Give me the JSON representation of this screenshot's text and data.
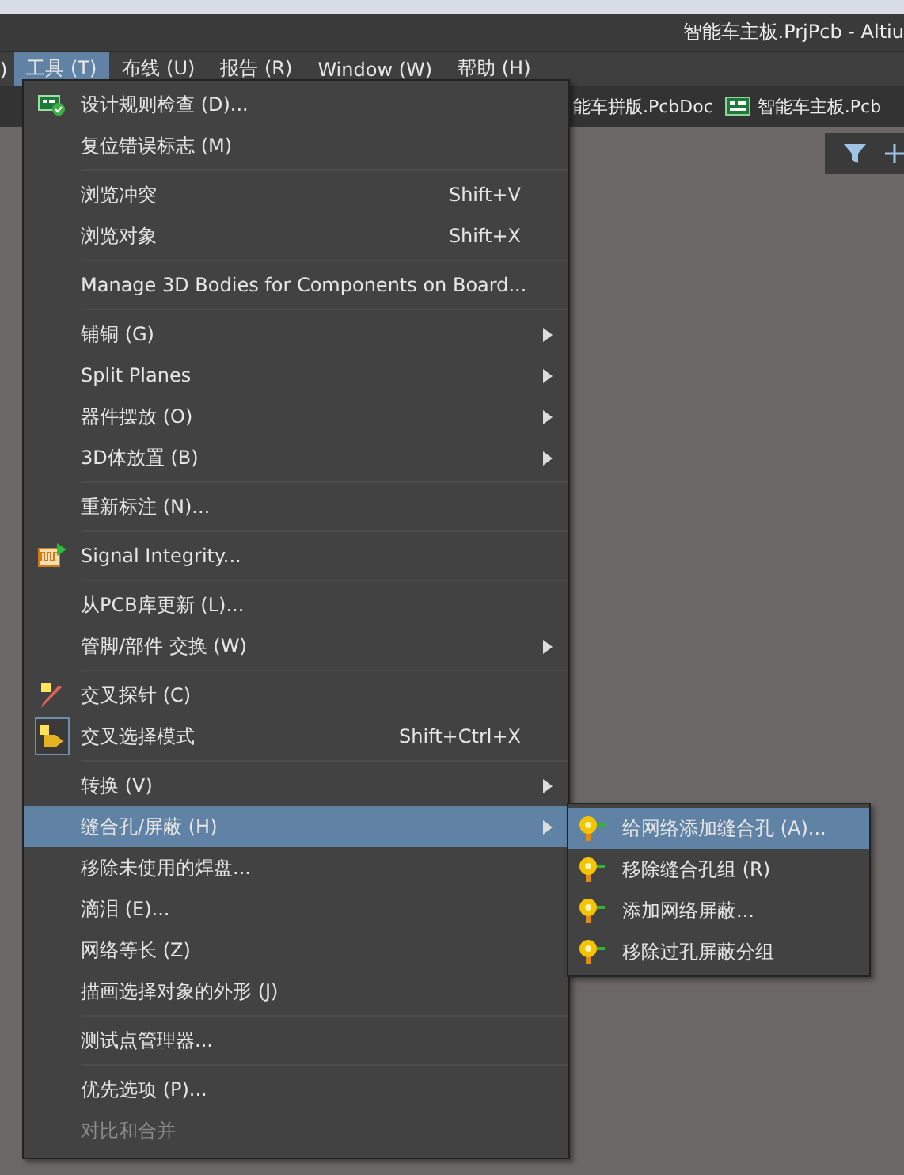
{
  "window": {
    "title": "智能车主板.PrjPcb - Altiu"
  },
  "menubar": [
    {
      "label": ")",
      "selected": false
    },
    {
      "label": "工具 (T)",
      "selected": true
    },
    {
      "label": "布线 (U)",
      "selected": false
    },
    {
      "label": "报告 (R)",
      "selected": false
    },
    {
      "label": "Window (W)",
      "selected": false
    },
    {
      "label": "帮助 (H)",
      "selected": false
    }
  ],
  "doc_tabs": [
    {
      "label": "能车拼版.PcbDoc",
      "icon": false
    },
    {
      "label": "智能车主板.Pcb",
      "icon": true
    }
  ],
  "menu": [
    {
      "kind": "check",
      "label": "设计规则检查 (D)...",
      "selected": false,
      "disabled": false,
      "checked": false,
      "submenu": false
    },
    {
      "kind": "item",
      "label": "复位错误标志 (M)",
      "selected": false,
      "disabled": false,
      "checked": false,
      "submenu": false
    },
    {
      "kind": "separator"
    },
    {
      "kind": "item",
      "label": "浏览冲突",
      "shortcut": "Shift+V",
      "selected": false,
      "disabled": false,
      "checked": false,
      "submenu": false
    },
    {
      "kind": "item",
      "label": "浏览对象",
      "shortcut": "Shift+X",
      "selected": false,
      "disabled": false,
      "checked": false,
      "submenu": false
    },
    {
      "kind": "separator"
    },
    {
      "kind": "item",
      "label": "Manage 3D Bodies for Components on Board...",
      "selected": false,
      "disabled": false,
      "checked": false,
      "submenu": false
    },
    {
      "kind": "separator"
    },
    {
      "kind": "item",
      "label": "铺铜 (G)",
      "selected": false,
      "disabled": false,
      "checked": false,
      "submenu": true
    },
    {
      "kind": "item",
      "label": "Split Planes",
      "selected": false,
      "disabled": false,
      "checked": false,
      "submenu": true
    },
    {
      "kind": "item",
      "label": "器件摆放 (O)",
      "selected": false,
      "disabled": false,
      "checked": false,
      "submenu": true
    },
    {
      "kind": "item",
      "label": "3D体放置 (B)",
      "selected": false,
      "disabled": false,
      "checked": false,
      "submenu": true
    },
    {
      "kind": "separator"
    },
    {
      "kind": "item",
      "label": "重新标注 (N)...",
      "selected": false,
      "disabled": false,
      "checked": false,
      "submenu": false
    },
    {
      "kind": "separator"
    },
    {
      "kind": "signal",
      "label": "Signal Integrity...",
      "selected": false,
      "disabled": false,
      "checked": false,
      "submenu": false
    },
    {
      "kind": "separator"
    },
    {
      "kind": "item",
      "label": "从PCB库更新 (L)...",
      "selected": false,
      "disabled": false,
      "checked": false,
      "submenu": false
    },
    {
      "kind": "item",
      "label": "管脚/部件 交换 (W)",
      "selected": false,
      "disabled": false,
      "checked": false,
      "submenu": true
    },
    {
      "kind": "separator"
    },
    {
      "kind": "probe",
      "label": "交叉探针 (C)",
      "selected": false,
      "disabled": false,
      "checked": false,
      "submenu": false
    },
    {
      "kind": "crossselect",
      "label": "交叉选择模式",
      "shortcut": "Shift+Ctrl+X",
      "selected": false,
      "disabled": false,
      "checked": true,
      "submenu": false
    },
    {
      "kind": "separator"
    },
    {
      "kind": "item",
      "label": "转换 (V)",
      "selected": false,
      "disabled": false,
      "checked": false,
      "submenu": true
    },
    {
      "kind": "item",
      "label": "缝合孔/屏蔽 (H)",
      "selected": true,
      "disabled": false,
      "checked": false,
      "submenu": true
    },
    {
      "kind": "item",
      "label": "移除未使用的焊盘...",
      "selected": false,
      "disabled": false,
      "checked": false,
      "submenu": false
    },
    {
      "kind": "item",
      "label": "滴泪 (E)...",
      "selected": false,
      "disabled": false,
      "checked": false,
      "submenu": false
    },
    {
      "kind": "item",
      "label": "网络等长 (Z)",
      "selected": false,
      "disabled": false,
      "checked": false,
      "submenu": false
    },
    {
      "kind": "item",
      "label": "描画选择对象的外形 (J)",
      "selected": false,
      "disabled": false,
      "checked": false,
      "submenu": false
    },
    {
      "kind": "separator"
    },
    {
      "kind": "item",
      "label": "测试点管理器...",
      "selected": false,
      "disabled": false,
      "checked": false,
      "submenu": false
    },
    {
      "kind": "separator"
    },
    {
      "kind": "item",
      "label": "优先选项 (P)...",
      "selected": false,
      "disabled": false,
      "checked": false,
      "submenu": false
    },
    {
      "kind": "item",
      "label": "对比和合并",
      "selected": false,
      "disabled": true,
      "checked": false,
      "submenu": false
    }
  ],
  "submenu": [
    {
      "label": "给网络添加缝合孔 (A)...",
      "selected": true
    },
    {
      "label": "移除缝合孔组 (R)",
      "selected": false
    },
    {
      "label": "添加网络屏蔽...",
      "selected": false
    },
    {
      "label": "移除过孔屏蔽分组",
      "selected": false
    }
  ]
}
